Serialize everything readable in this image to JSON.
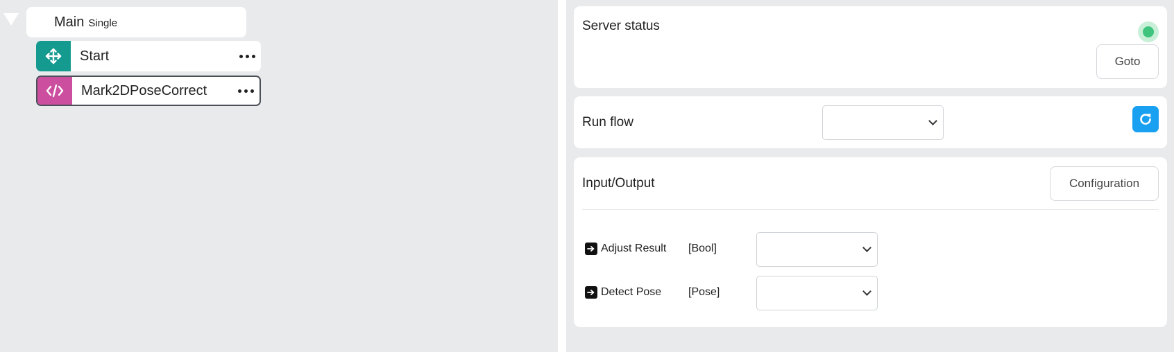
{
  "tree": {
    "main": {
      "title": "Main",
      "subtitle": "Single"
    },
    "steps": [
      {
        "label": "Start",
        "icon": "move-arrows-icon",
        "color": "#159a8f",
        "selected": false
      },
      {
        "label": "Mark2DPoseCorrect",
        "icon": "code-icon",
        "color": "#cc4f9f",
        "selected": true
      }
    ]
  },
  "server_status": {
    "title": "Server status",
    "indicator_color": "#3ec47c",
    "goto_label": "Goto"
  },
  "run_flow": {
    "title": "Run flow",
    "selected_value": "",
    "refresh_color": "#1aa0f0"
  },
  "io": {
    "title": "Input/Output",
    "config_label": "Configuration",
    "rows": [
      {
        "name": "Adjust Result",
        "type": "[Bool]",
        "value": ""
      },
      {
        "name": "Detect Pose",
        "type": "[Pose]",
        "value": ""
      }
    ]
  }
}
